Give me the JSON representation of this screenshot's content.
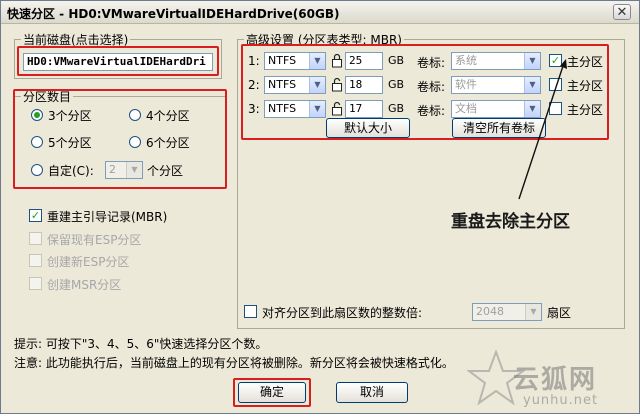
{
  "window": {
    "title": "快速分区 - HD0:VMwareVirtualIDEHardDrive(60GB)",
    "close_glyph": "✕"
  },
  "current_disk": {
    "label": "当前磁盘(点击选择)",
    "value": "HD0:VMwareVirtualIDEHardDri"
  },
  "partition_count": {
    "label": "分区数目",
    "opt3": "3个分区",
    "opt4": "4个分区",
    "opt5": "5个分区",
    "opt6": "6个分区",
    "custom": "自定(C):",
    "custom_value": "2",
    "custom_suffix": "个分区",
    "selected": "3"
  },
  "options": {
    "rebuild_mbr": "重建主引导记录(MBR)",
    "keep_esp": "保留现有ESP分区",
    "create_esp": "创建新ESP分区",
    "create_msr": "创建MSR分区"
  },
  "advanced": {
    "label": "高级设置 (分区表类型: MBR)",
    "size_unit": "GB",
    "volume_label": "卷标:",
    "primary_label": "主分区",
    "rows": [
      {
        "num": "1:",
        "fs": "NTFS",
        "size": "25",
        "vol": "系统",
        "primary": true
      },
      {
        "num": "2:",
        "fs": "NTFS",
        "size": "18",
        "vol": "软件",
        "primary": false
      },
      {
        "num": "3:",
        "fs": "NTFS",
        "size": "17",
        "vol": "文档",
        "primary": false
      }
    ],
    "default_size_button": "默认大小",
    "clear_labels_button": "清空所有卷标"
  },
  "annotation": "重盘去除主分区",
  "align": {
    "label": "对齐分区到此扇区数的整数倍:",
    "value": "2048",
    "unit": "扇区"
  },
  "hints": {
    "tip": "提示: 可按下\"3、4、5、6\"快速选择分区个数。",
    "warning": "注意: 此功能执行后，当前磁盘上的现有分区将被删除。新分区将会被快速格式化。"
  },
  "buttons": {
    "ok": "确定",
    "cancel": "取消"
  },
  "watermark": {
    "brand": "云狐网",
    "url": "yunhu.net"
  },
  "colors": {
    "highlight_red": "#d81e1e",
    "dialog_bg": "#ece9d8"
  }
}
